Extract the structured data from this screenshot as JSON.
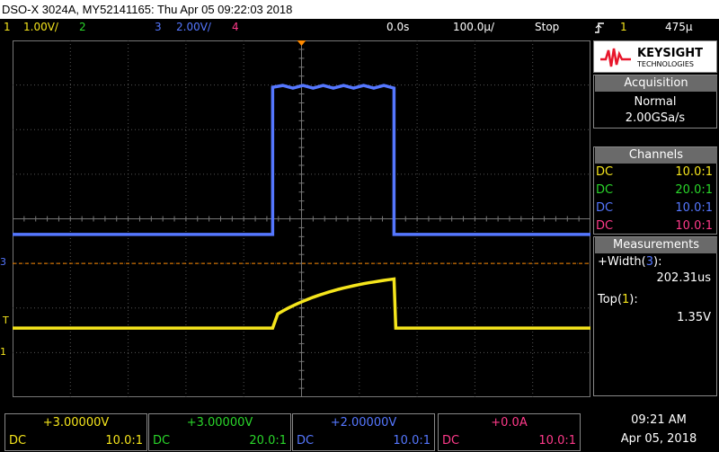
{
  "title_bar": "DSO-X 3024A, MY52141165: Thu Apr 05 09:22:03 2018",
  "status": {
    "ch1_num": "1",
    "ch1_scale": "1.00V/",
    "ch2_num": "2",
    "ch3_num": "3",
    "ch3_scale": "2.00V/",
    "ch4_num": "4",
    "time_delay": "0.0s",
    "time_scale": "100.0µ/",
    "run_state": "Stop",
    "trigger_icon": "rising-edge-trigger-icon",
    "trigger_source": "1",
    "trigger_level": "475µ"
  },
  "brand": {
    "name": "KEYSIGHT",
    "sub": "TECHNOLOGIES",
    "logo_icon": "keysight-wave-logo-icon",
    "logo_color": "#e8162b"
  },
  "acquisition": {
    "header": "Acquisition",
    "mode": "Normal",
    "rate": "2.00GSa/s"
  },
  "channels": {
    "header": "Channels",
    "rows": [
      {
        "coupling": "DC",
        "probe": "10.0:1",
        "color": "#f5e51c"
      },
      {
        "coupling": "DC",
        "probe": "20.0:1",
        "color": "#2ad62a"
      },
      {
        "coupling": "DC",
        "probe": "10.0:1",
        "color": "#5577ff"
      },
      {
        "coupling": "DC",
        "probe": "10.0:1",
        "color": "#ff3a8a"
      }
    ]
  },
  "measurements": {
    "header": "Measurements",
    "m1_label_pre": "+Width(",
    "m1_ch": "3",
    "m1_label_post": "):",
    "m1_value": "202.31us",
    "m2_label_pre": "Top(",
    "m2_ch": "1",
    "m2_label_post": "):",
    "m2_value": "1.35V"
  },
  "markers": {
    "ch3": "3",
    "ch1": "1",
    "trigger_level": "T"
  },
  "bottom": {
    "ch1": {
      "offset": "+3.00000V",
      "coupling": "DC",
      "probe": "10.0:1"
    },
    "ch2": {
      "offset": "+3.00000V",
      "coupling": "DC",
      "probe": "20.0:1"
    },
    "ch3": {
      "offset": "+2.00000V",
      "coupling": "DC",
      "probe": "10.0:1"
    },
    "ch4": {
      "offset": "+0.0A",
      "coupling": "DC",
      "probe": "10.0:1"
    },
    "time": "09:21 AM",
    "date": "Apr 05, 2018"
  },
  "colors": {
    "ch1": "#f5e51c",
    "ch2": "#2ad62a",
    "ch3": "#5577ff",
    "ch4": "#ff3a8a",
    "trigger": "#ff8a00",
    "grid": "#555555"
  },
  "display_state": {
    "ch3_baseline_div": -0.35,
    "ch3_pulse_div": 2.95,
    "ch1_baseline_div": -2.45,
    "ch1_ramp_end_div": -1.35,
    "trigger_level_div": -1.0,
    "pulse_start_div": -0.5,
    "pulse_end_div": 1.6
  }
}
